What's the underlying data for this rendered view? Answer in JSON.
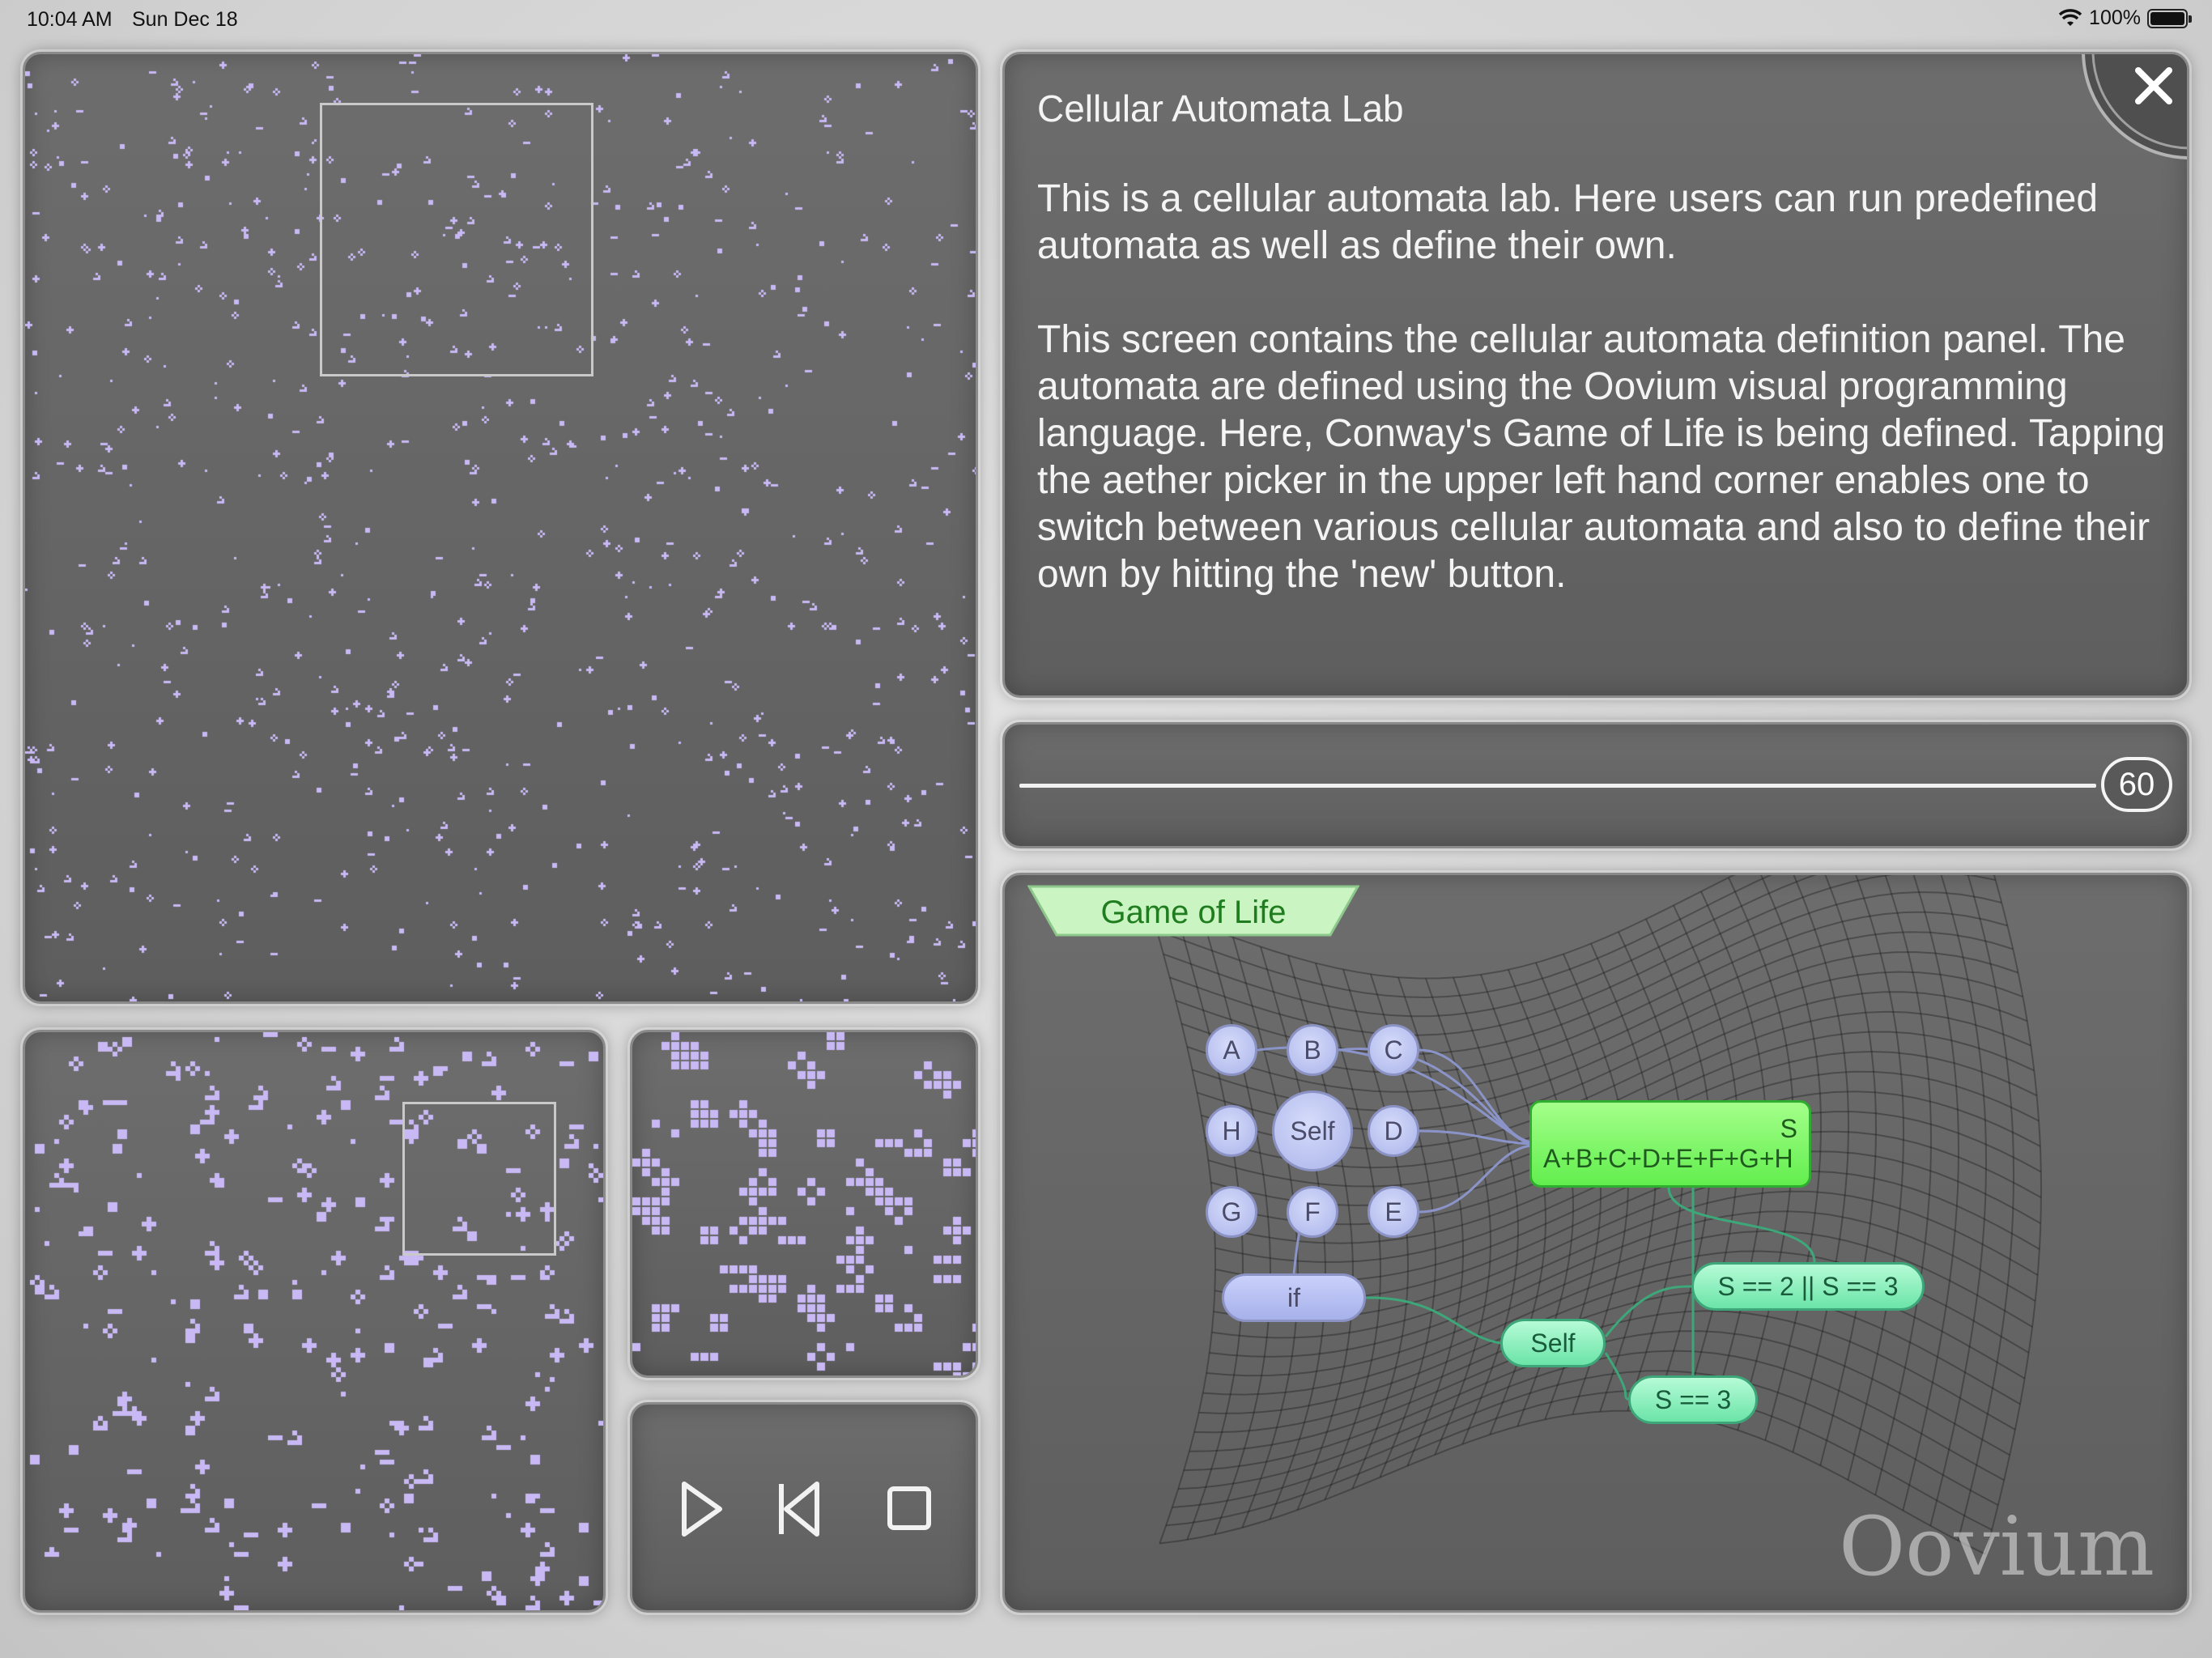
{
  "status_bar": {
    "time": "10:04 AM",
    "date": "Sun Dec 18",
    "battery": "100%"
  },
  "info": {
    "title": "Cellular Automata Lab",
    "paragraph1": "This is a cellular automata lab.  Here users can run predefined automata as well as define their own.",
    "paragraph2": "This screen contains the cellular automata definition panel.  The automata are defined using the Oovium visual programming language.  Here, Conway's Game of Life is being defined.  Tapping the aether picker in the upper left hand corner enables one to switch between various cellular automata and also to define their own by hitting the 'new' button.",
    "close_icon": "close-icon"
  },
  "slider": {
    "value": "60"
  },
  "aether": {
    "tab": "Game of Life",
    "watermark": "Oovium",
    "neighbors": [
      "A",
      "B",
      "C",
      "D",
      "E",
      "F",
      "G",
      "H"
    ],
    "self": "Self",
    "sum_name": "S",
    "sum_expr": "A+B+C+D+E+F+G+H",
    "if_label": "if",
    "self2": "Self",
    "cond1": "S == 2 || S == 3",
    "cond2": "S == 3"
  },
  "controls": {
    "play_icon": "play-icon",
    "rewind_icon": "rewind-icon",
    "stop_icon": "stop-icon"
  },
  "colors": {
    "cell": "#c8b8f4",
    "panel": "#636363",
    "sum_box": "#7ef262",
    "cond": "#8ff0c0"
  }
}
